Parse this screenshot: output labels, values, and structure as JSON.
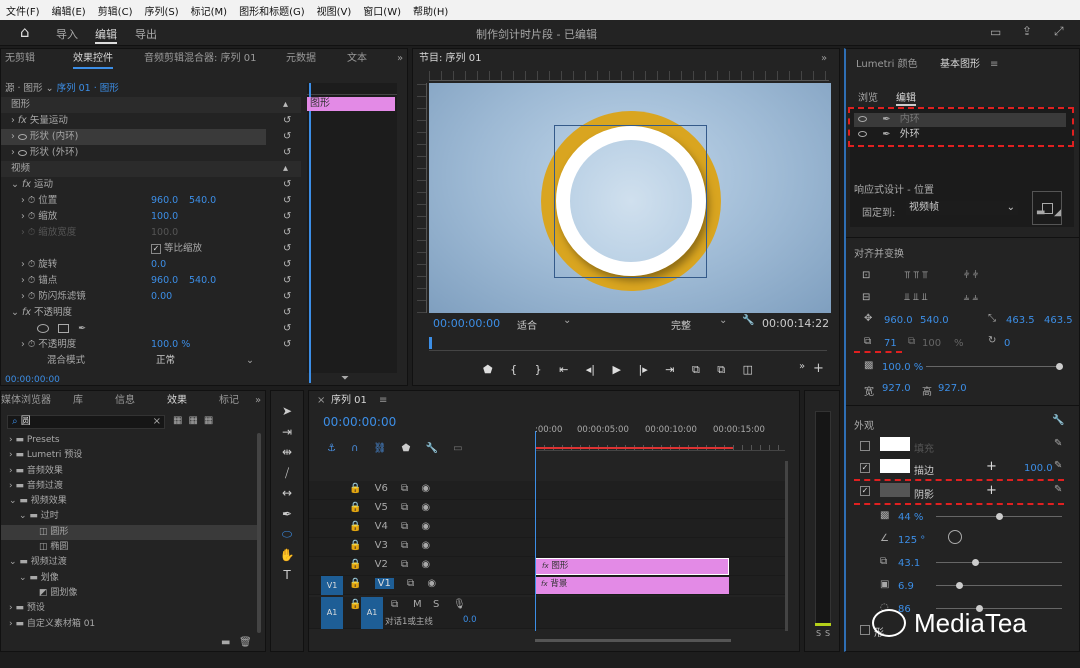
{
  "menu": [
    "文件(F)",
    "编辑(E)",
    "剪辑(C)",
    "序列(S)",
    "标记(M)",
    "图形和标题(G)",
    "视图(V)",
    "窗口(W)",
    "帮助(H)"
  ],
  "workspace": {
    "tabs": [
      "导入",
      "编辑",
      "导出"
    ],
    "title": "制作剑计时片段 - 已编辑"
  },
  "effect_controls": {
    "tabs": [
      "无剪辑",
      "效果控件",
      "音频剪辑混合器: 序列 01",
      "元数据",
      "文本"
    ],
    "source": "源 · 图形",
    "seq": "序列 01 · 图形",
    "clip": "图形",
    "sec_graphic": "图形",
    "vector": "矢量运动",
    "shape_inner": "形状 (内环)",
    "shape_outer": "形状 (外环)",
    "sec_video": "视频",
    "motion": "运动",
    "pos_label": "位置",
    "pos_x": "960.0",
    "pos_y": "540.0",
    "scale_label": "缩放",
    "scale_val": "100.0",
    "scalew_label": "缩放宽度",
    "scalew_val": "100.0",
    "uniform": "等比缩放",
    "rot_label": "旋转",
    "rot_val": "0.0",
    "anchor_label": "锚点",
    "anchor_x": "960.0",
    "anchor_y": "540.0",
    "flicker_label": "防闪烁滤镜",
    "flicker_val": "0.00",
    "opacity": "不透明度",
    "op_label": "不透明度",
    "op_val": "100.0 %",
    "blend_label": "混合模式",
    "blend_val": "正常",
    "timecode": "00:00:00:00"
  },
  "program": {
    "title": "节目: 序列 01",
    "tc_left": "00:00:00:00",
    "fit": "适合",
    "quality": "完整",
    "tc_right": "00:00:14:22"
  },
  "project": {
    "tabs": [
      "媒体浏览器",
      "库",
      "信息",
      "效果",
      "标记"
    ],
    "search": "圆",
    "tree": [
      "Presets",
      "Lumetri 预设",
      "音频效果",
      "音频过渡",
      "视频效果",
      "过时",
      "圆形",
      "椭圆",
      "视频过渡",
      "划像",
      "圆划像",
      "预设",
      "自定义素材箱 01"
    ]
  },
  "timeline": {
    "tab": "序列 01",
    "tc": "00:00:00:00",
    "ruler": [
      ":00:00",
      "00:00:05:00",
      "00:00:10:00",
      "00:00:15:00"
    ],
    "tracks": [
      "V6",
      "V5",
      "V4",
      "V3",
      "V2",
      "V1",
      "A1"
    ],
    "src_v1": "V1",
    "src_a1": "A1",
    "clip_v2": "图形",
    "clip_v1": "背景",
    "mix": "对话1或主线",
    "mix_val": "0.0",
    "mute": "M",
    "solo": "S",
    "meter_labels": [
      "S",
      "S"
    ]
  },
  "eg": {
    "tabs": [
      "Lumetri 颜色",
      "基本图形"
    ],
    "sub": [
      "浏览",
      "编辑"
    ],
    "layers": [
      "内环",
      "外环"
    ],
    "resp": "响应式设计 - 位置",
    "pin_label": "固定到:",
    "pin_val": "视频帧",
    "align": "对齐并变换",
    "pos_x": "960.0",
    "pos_y": "540.0",
    "size_w": "463.5",
    "size_h": "463.5",
    "rot": "71",
    "scale_pct": "100",
    "unit_pct": "%",
    "rot2": "0",
    "opacity": "100.0 %",
    "w_label": "宽",
    "w_val": "927.0",
    "h_label": "高",
    "h_val": "927.0",
    "appearance": "外观",
    "fill": "填充",
    "stroke": "描边",
    "stroke_w": "100.0",
    "shadow": "阴影",
    "sh_opacity": "44 %",
    "sh_angle": "125 °",
    "sh_dist": "43.1",
    "sh_size": "6.9",
    "sh_blur": "86",
    "mask": "形"
  },
  "watermark": "MediaTea"
}
